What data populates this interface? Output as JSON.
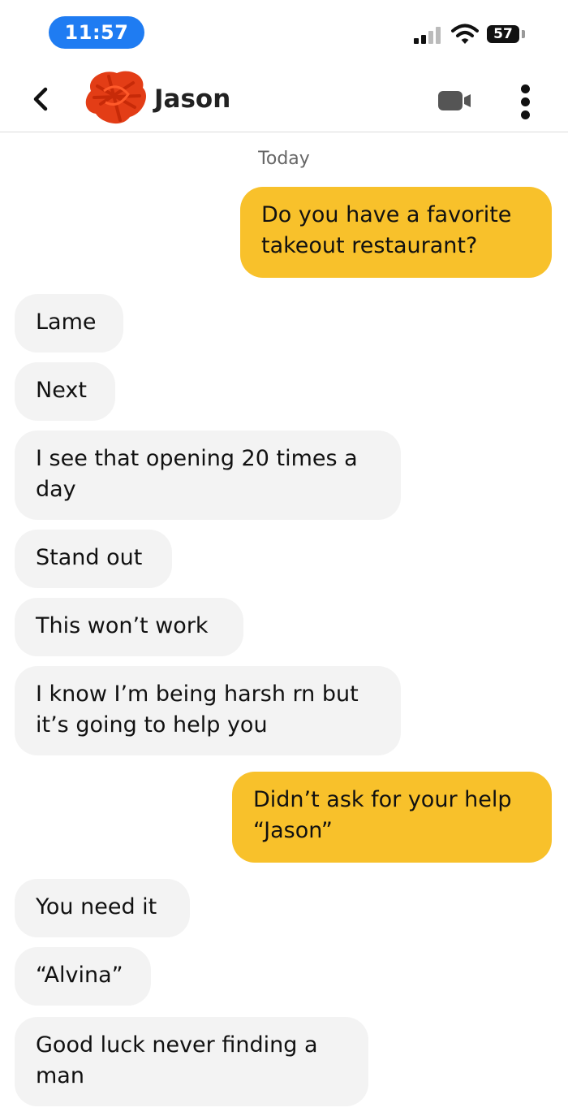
{
  "status_bar": {
    "time": "11:57",
    "battery": "57",
    "accent_color": "#1f7cf2"
  },
  "header": {
    "contact_name": "Jason",
    "icons": [
      "back-chevron-icon",
      "video-call-icon",
      "more-vertical-icon"
    ]
  },
  "conversation": {
    "date_label": "Today",
    "colors": {
      "outgoing": "#f8c12b",
      "incoming": "#f3f3f3"
    },
    "messages": [
      {
        "from": "me",
        "text": "Do you have a favorite takeout restaurant?"
      },
      {
        "from": "them",
        "text": "Lame"
      },
      {
        "from": "them",
        "text": "Next"
      },
      {
        "from": "them",
        "text": "I see that opening 20 times a day"
      },
      {
        "from": "them",
        "text": "Stand out"
      },
      {
        "from": "them",
        "text": "This won’t work"
      },
      {
        "from": "them",
        "text": "I know I’m being harsh rn but it’s going to help you"
      },
      {
        "from": "me",
        "text": "Didn’t ask for your help “Jason”"
      },
      {
        "from": "them",
        "text": "You need it"
      },
      {
        "from": "them",
        "text": "“Alvina”"
      },
      {
        "from": "them",
        "text": "Good luck never finding a man"
      }
    ]
  }
}
